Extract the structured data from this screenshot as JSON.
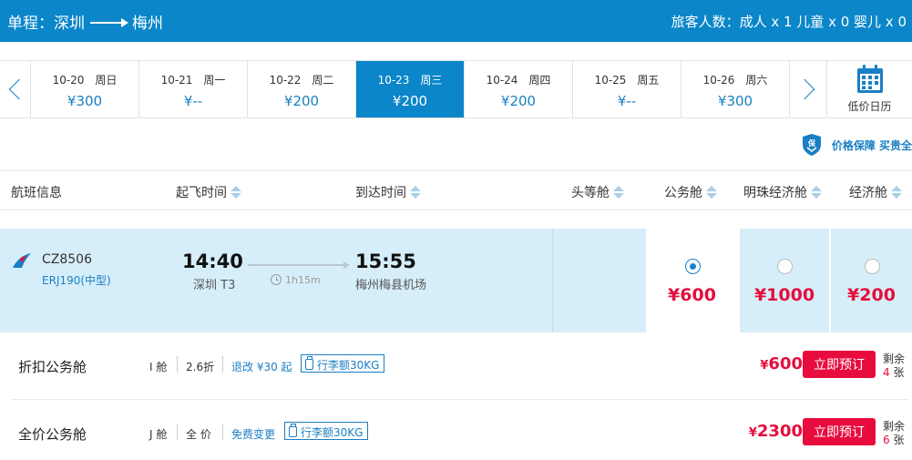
{
  "header": {
    "route_prefix": "单程：",
    "from": "深圳",
    "to": "梅州",
    "passengers": "旅客人数：成人 x 1 儿童 x 0 婴儿 x 0"
  },
  "dates": [
    {
      "label": "10-20　周日",
      "price": "¥300"
    },
    {
      "label": "10-21　周一",
      "price": "¥--"
    },
    {
      "label": "10-22　周二",
      "price": "¥200"
    },
    {
      "label": "10-23　周三",
      "price": "¥200"
    },
    {
      "label": "10-24　周四",
      "price": "¥200"
    },
    {
      "label": "10-25　周五",
      "price": "¥--"
    },
    {
      "label": "10-26　周六",
      "price": "¥300"
    }
  ],
  "selected_date_index": 3,
  "calendar_label": "低价日历",
  "guarantee": {
    "text": "价格保障 买贵全"
  },
  "columns": {
    "flight": "航班信息",
    "depart": "起飞时间",
    "arrive": "到达时间",
    "first": "头等舱",
    "business": "公务舱",
    "pearl": "明珠经济舱",
    "economy": "经济舱"
  },
  "flight": {
    "number": "CZ8506",
    "aircraft": "ERJ190(中型)",
    "dep_time": "14:40",
    "dep_airport": "深圳 T3",
    "arr_time": "15:55",
    "arr_airport": "梅州梅县机场",
    "duration": "1h15m",
    "fares": {
      "business": "¥600",
      "pearl": "¥1000",
      "economy": "¥200"
    }
  },
  "cabins": [
    {
      "name": "折扣公务舱",
      "class": "I 舱",
      "discount": "2.6折",
      "rule": "退改 ¥30 起",
      "baggage": "行李额30KG",
      "currency": "¥",
      "price": "600",
      "book": "立即预订",
      "rem_label": "剩余",
      "rem_count": "4",
      "rem_unit": "张"
    },
    {
      "name": "全价公务舱",
      "class": "J 舱",
      "discount": "全 价",
      "rule": "免费变更",
      "baggage": "行李额30KG",
      "currency": "¥",
      "price": "2300",
      "book": "立即预订",
      "rem_label": "剩余",
      "rem_count": "6",
      "rem_unit": "张"
    }
  ],
  "colors": {
    "primary": "#0a86c9",
    "price_red": "#e50e3c",
    "row_highlight": "#d6eef9"
  }
}
